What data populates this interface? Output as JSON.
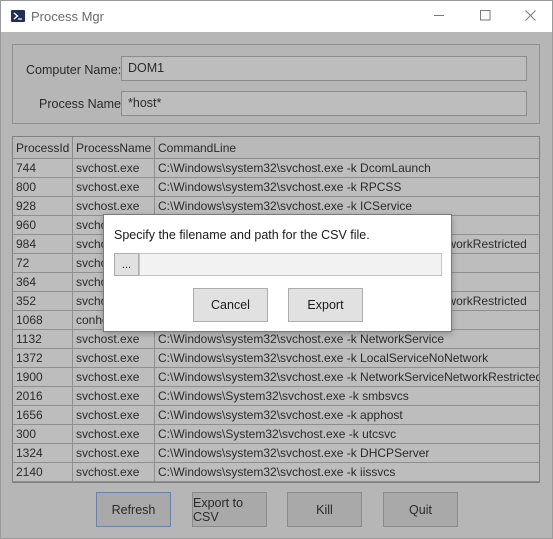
{
  "window": {
    "title": "Process Mgr",
    "icon": "powershell-icon"
  },
  "form": {
    "computer_label": "Computer Name:",
    "computer_value": "DOM1",
    "process_label": "Process Name:",
    "process_value": "*host*"
  },
  "grid": {
    "columns": [
      "ProcessId",
      "ProcessName",
      "CommandLine"
    ],
    "rows": [
      [
        "744",
        "svchost.exe",
        "C:\\Windows\\system32\\svchost.exe -k DcomLaunch"
      ],
      [
        "800",
        "svchost.exe",
        "C:\\Windows\\system32\\svchost.exe -k RPCSS"
      ],
      [
        "928",
        "svchost.exe",
        "C:\\Windows\\system32\\svchost.exe -k ICService"
      ],
      [
        "960",
        "svchost.exe",
        ""
      ],
      [
        "984",
        "svchost.exe",
        "C:\\Windows\\system32\\svchost.exe -k LocalServiceNetworkRestricted"
      ],
      [
        "72",
        "svchost.exe",
        ""
      ],
      [
        "364",
        "svchost.exe",
        ""
      ],
      [
        "352",
        "svchost.exe",
        "C:\\Windows\\system32\\svchost.exe -k LocalSystemNetworkRestricted"
      ],
      [
        "1068",
        "conhost.exe",
        ""
      ],
      [
        "1132",
        "svchost.exe",
        "C:\\Windows\\system32\\svchost.exe -k NetworkService"
      ],
      [
        "1372",
        "svchost.exe",
        "C:\\Windows\\system32\\svchost.exe -k LocalServiceNoNetwork"
      ],
      [
        "1900",
        "svchost.exe",
        "C:\\Windows\\system32\\svchost.exe -k NetworkServiceNetworkRestricted"
      ],
      [
        "2016",
        "svchost.exe",
        "C:\\Windows\\System32\\svchost.exe -k smbsvcs"
      ],
      [
        "1656",
        "svchost.exe",
        "C:\\Windows\\system32\\svchost.exe -k apphost"
      ],
      [
        "300",
        "svchost.exe",
        "C:\\Windows\\System32\\svchost.exe -k utcsvc"
      ],
      [
        "1324",
        "svchost.exe",
        "C:\\Windows\\system32\\svchost.exe -k DHCPServer"
      ],
      [
        "2140",
        "svchost.exe",
        "C:\\Windows\\system32\\svchost.exe -k iissvcs"
      ]
    ]
  },
  "buttons": {
    "refresh": "Refresh",
    "export": "Export to CSV",
    "kill": "Kill",
    "quit": "Quit"
  },
  "dialog": {
    "message": "Specify the filename and path for the CSV file.",
    "browse_label": "...",
    "path_value": "",
    "cancel": "Cancel",
    "export": "Export"
  }
}
